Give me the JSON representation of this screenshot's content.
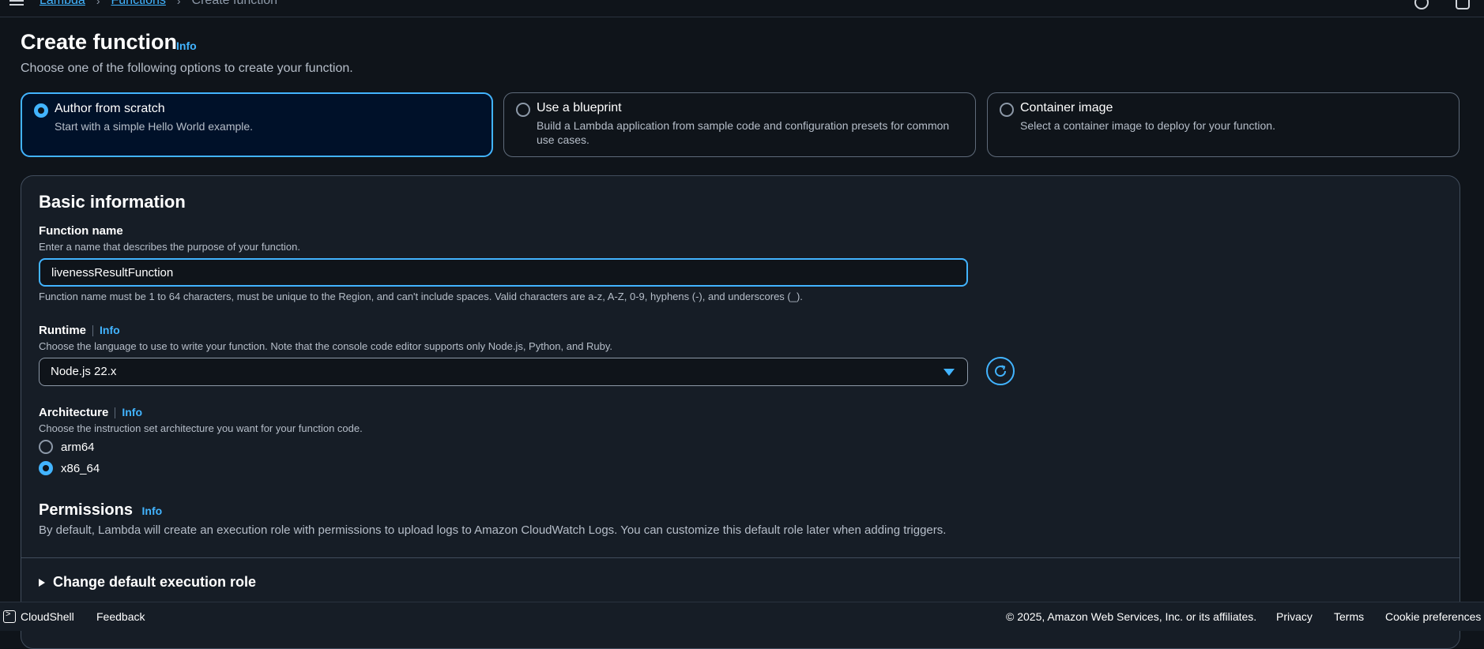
{
  "breadcrumb": {
    "items": [
      "Lambda",
      "Functions"
    ],
    "current": "Create function"
  },
  "header": {
    "title": "Create function",
    "info": "Info",
    "description": "Choose one of the following options to create your function."
  },
  "options": [
    {
      "title": "Author from scratch",
      "description": "Start with a simple Hello World example.",
      "selected": true
    },
    {
      "title": "Use a blueprint",
      "description": "Build a Lambda application from sample code and configuration presets for common use cases.",
      "selected": false
    },
    {
      "title": "Container image",
      "description": "Select a container image to deploy for your function.",
      "selected": false
    }
  ],
  "basic_info": {
    "title": "Basic information",
    "function_name": {
      "label": "Function name",
      "description": "Enter a name that describes the purpose of your function.",
      "value": "livenessResultFunction",
      "constraint": "Function name must be 1 to 64 characters, must be unique to the Region, and can't include spaces. Valid characters are a-z, A-Z, 0-9, hyphens (-), and underscores (_)."
    },
    "runtime": {
      "label": "Runtime",
      "info": "Info",
      "description": "Choose the language to use to write your function. Note that the console code editor supports only Node.js, Python, and Ruby.",
      "value": "Node.js 22.x"
    },
    "architecture": {
      "label": "Architecture",
      "info": "Info",
      "description": "Choose the instruction set architecture you want for your function code.",
      "options": [
        "arm64",
        "x86_64"
      ],
      "selected": "x86_64"
    },
    "permissions": {
      "title": "Permissions",
      "info": "Info",
      "description": "By default, Lambda will create an execution role with permissions to upload logs to Amazon CloudWatch Logs. You can customize this default role later when adding triggers."
    },
    "expander": "Change default execution role"
  },
  "footer": {
    "cloudshell": "CloudShell",
    "feedback": "Feedback",
    "copyright": "© 2025, Amazon Web Services, Inc. or its affiliates.",
    "privacy": "Privacy",
    "terms": "Terms",
    "cookies": "Cookie preferences"
  },
  "colors": {
    "accent": "#42b4ff",
    "background": "#0f141a",
    "card": "#161d26"
  }
}
